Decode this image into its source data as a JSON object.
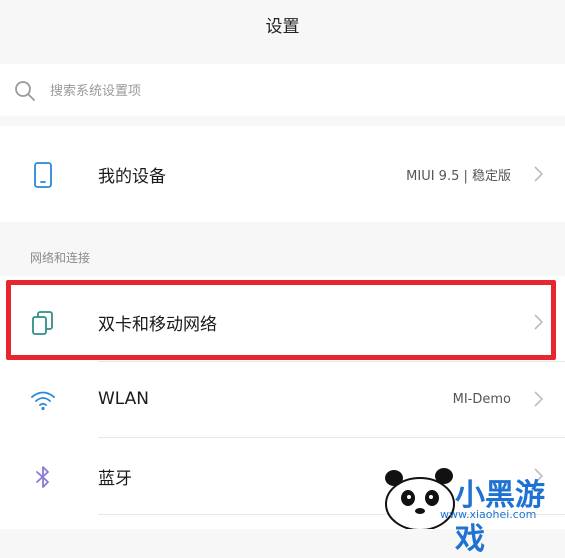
{
  "header": {
    "title": "设置"
  },
  "search": {
    "placeholder": "搜索系统设置项"
  },
  "device": {
    "label": "我的设备",
    "value": "MIUI 9.5 | 稳定版"
  },
  "section": {
    "title": "网络和连接"
  },
  "network_items": [
    {
      "label": "双卡和移动网络",
      "value": "",
      "icon": "sim-cards-icon"
    },
    {
      "label": "WLAN",
      "value": "MI-Demo",
      "icon": "wifi-icon"
    },
    {
      "label": "蓝牙",
      "value": "",
      "icon": "bluetooth-icon"
    }
  ],
  "watermark": {
    "brand": "小黑游戏",
    "url": "www.xiaohei.com"
  },
  "colors": {
    "highlight": "#e8262d",
    "icon_teal": "#2f8f86",
    "icon_blue": "#2a88d6",
    "icon_purple": "#8b7ad6"
  }
}
